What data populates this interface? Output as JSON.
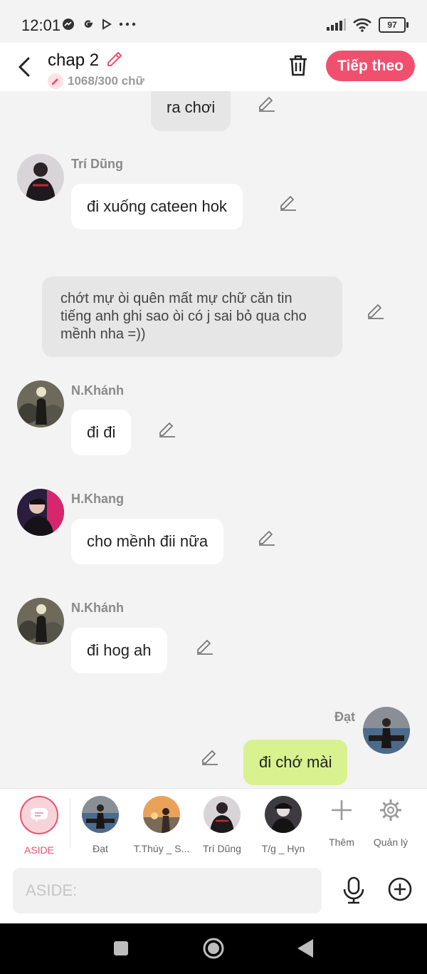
{
  "status_bar": {
    "time": "12:01",
    "battery": "97"
  },
  "header": {
    "title": "chap 2",
    "counter": "1068/300 chữ",
    "next_label": "Tiếp theo"
  },
  "messages": {
    "m0": {
      "text": "ra chơi"
    },
    "m1": {
      "sender": "Trí Dũng",
      "text": "đi xuống cateen hok"
    },
    "m2": {
      "text": "chớt mự òi quên mất mự chữ căn tin tiếng anh ghi sao òi có j sai bỏ qua cho mềnh nha =))"
    },
    "m3": {
      "sender": "N.Khánh",
      "text": "đi đi"
    },
    "m4": {
      "sender": "H.Khang",
      "text": "cho mềnh đii nữa"
    },
    "m5": {
      "sender": "N.Khánh",
      "text": "đi hog ah"
    },
    "m6": {
      "sender": "Đạt",
      "text": "đi chớ mài"
    }
  },
  "tabs": [
    {
      "label": "ASIDE"
    },
    {
      "label": "Đạt"
    },
    {
      "label": "T.Thúy _ S..."
    },
    {
      "label": "Trí Dũng"
    },
    {
      "label": "T/g _ Hyn"
    },
    {
      "label": "Thêm"
    },
    {
      "label": "Quản lý"
    }
  ],
  "input": {
    "placeholder": "ASIDE:"
  },
  "colors": {
    "accent": "#f0506e",
    "self_bubble": "#d7f28f",
    "aside_bubble": "#e6e6e6"
  }
}
